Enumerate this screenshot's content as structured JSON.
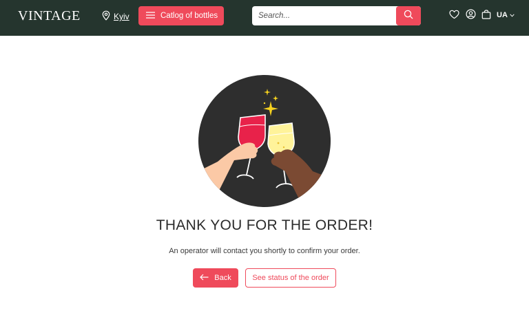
{
  "header": {
    "logo": "VINTAGE",
    "city": "Kyiv",
    "catalog_label": "Catlog of bottles",
    "search_placeholder": "Search...",
    "language": "UA"
  },
  "main": {
    "title": "THANK YOU FOR THE ORDER!",
    "message": "An operator will contact you shortly to confirm your order.",
    "back_label": "Back",
    "status_label": "See status of the order"
  },
  "colors": {
    "header_bg": "#25352e",
    "accent": "#ef4a5b",
    "illustration_bg": "#2e2e2e"
  }
}
